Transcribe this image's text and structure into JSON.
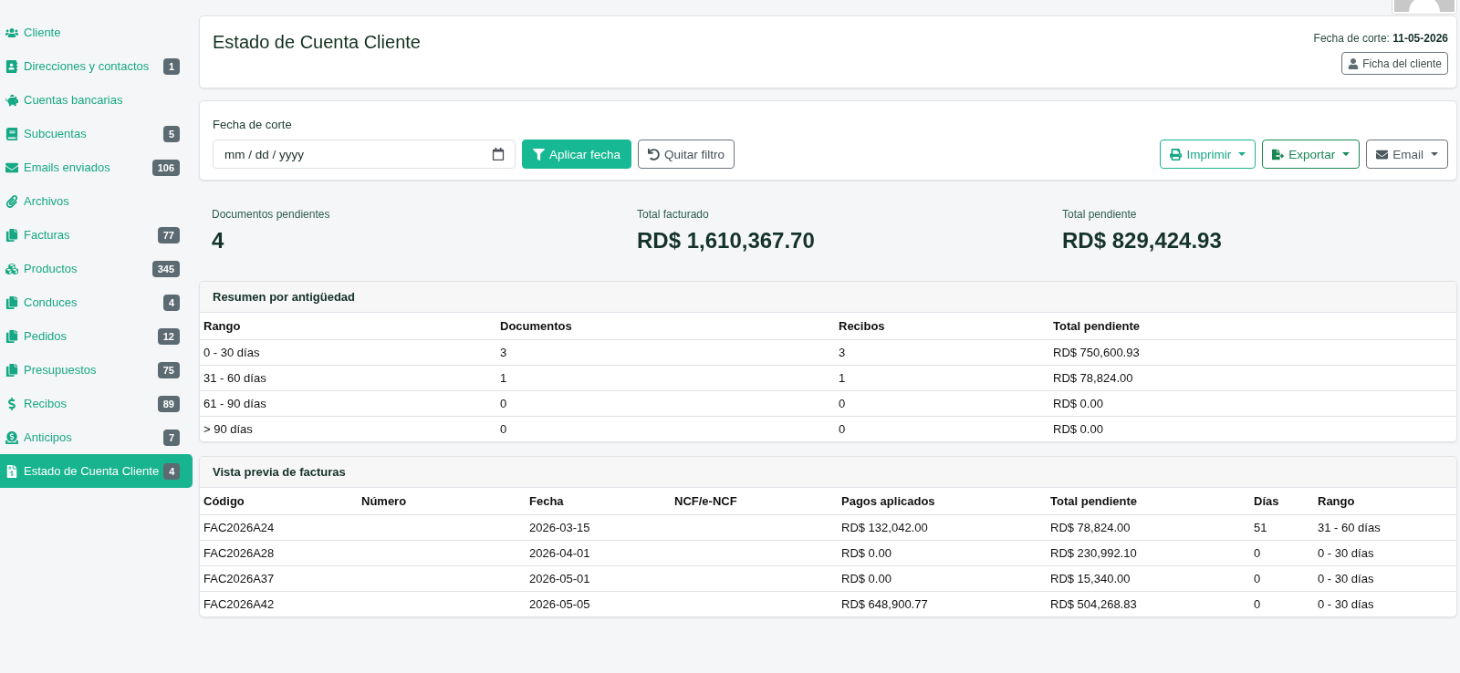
{
  "sidebar": {
    "items": [
      {
        "label": "Cliente",
        "selected": false
      },
      {
        "label": "Direcciones y contactos",
        "badge": "1",
        "selected": false
      },
      {
        "label": "Cuentas bancarias",
        "selected": false
      },
      {
        "label": "Subcuentas",
        "badge": "5",
        "selected": false
      },
      {
        "label": "Emails enviados",
        "badge": "106",
        "selected": false
      },
      {
        "label": "Archivos",
        "selected": false
      },
      {
        "label": "Facturas",
        "badge": "77",
        "selected": false
      },
      {
        "label": "Productos",
        "badge": "345",
        "selected": false
      },
      {
        "label": "Conduces",
        "badge": "4",
        "selected": false
      },
      {
        "label": "Pedidos",
        "badge": "12",
        "selected": false
      },
      {
        "label": "Presupuestos",
        "badge": "75",
        "selected": false
      },
      {
        "label": "Recibos",
        "badge": "89",
        "selected": false
      },
      {
        "label": "Anticipos",
        "badge": "7",
        "selected": false
      },
      {
        "label": "Estado de Cuenta Cliente",
        "badge": "4",
        "selected": true
      }
    ]
  },
  "header": {
    "title": "Estado de Cuenta Cliente",
    "cutoff": "Fecha de corte: **11-05-2026**",
    "profile_button": "Ficha del cliente"
  },
  "filter": {
    "label": "Fecha de corte",
    "date_field": {
      "placeholder": "mm / dd / yyyy"
    },
    "apply_button": "Aplicar fecha",
    "clear_button": "Quitar filtro",
    "actions": [
      {
        "label": "Imprimir",
        "kind": "print"
      },
      {
        "label": "Exportar",
        "kind": "export"
      },
      {
        "label": "Email",
        "kind": "email"
      }
    ]
  },
  "stats": [
    {
      "label": "Documentos pendientes",
      "value": "4"
    },
    {
      "label": "Total facturado",
      "value": "RD$ 1,610,367.70"
    },
    {
      "label": "Total pendiente",
      "value": "RD$ 829,424.93"
    }
  ],
  "aging": {
    "title": "Resumen por antigüedad",
    "columns": [
      "Rango",
      "Documentos",
      "Recibos",
      "Total pendiente"
    ],
    "rows": [
      [
        "0 - 30 días",
        "3",
        "3",
        "RD$ 750,600.93"
      ],
      [
        "31 - 60 días",
        "1",
        "1",
        "RD$ 78,824.00"
      ],
      [
        "61 - 90 días",
        "0",
        "0",
        "RD$ 0.00"
      ],
      [
        "> 90 días",
        "0",
        "0",
        "RD$ 0.00"
      ]
    ]
  },
  "invoices": {
    "title": "Vista previa de facturas",
    "columns": [
      "Código",
      "Número",
      "Fecha",
      "NCF/e-NCF",
      "Pagos aplicados",
      "Total pendiente",
      "Días",
      "Rango"
    ],
    "rows": [
      [
        "FAC2026A24",
        null,
        "2026-03-15",
        null,
        "RD$ 132,042.00",
        "RD$ 78,824.00",
        "51",
        "31 - 60 días"
      ],
      [
        "FAC2026A28",
        null,
        "2026-04-01",
        null,
        "RD$ 0.00",
        "RD$ 230,992.10",
        "0",
        "0 - 30 días"
      ],
      [
        "FAC2026A37",
        null,
        "2026-05-01",
        null,
        "RD$ 0.00",
        "RD$ 15,340.00",
        "0",
        "0 - 30 días"
      ],
      [
        "FAC2026A42",
        null,
        "2026-05-05",
        null,
        "RD$ 648,900.77",
        "RD$ 504,268.83",
        "0",
        "0 - 30 días"
      ]
    ]
  }
}
